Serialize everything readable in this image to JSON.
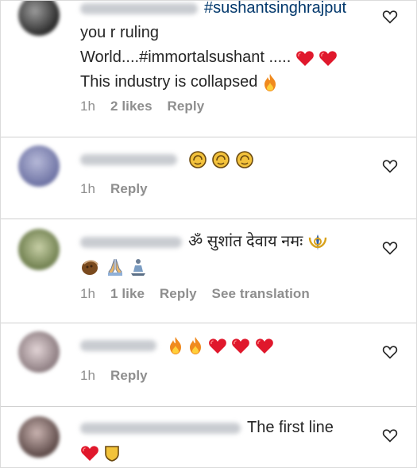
{
  "comments": [
    {
      "hashtag": "#sushantsinghrajput",
      "line2": "you r ruling",
      "line3": "World....#immortalsushant .....",
      "line4": "This industry is collapsed",
      "time": "1h",
      "likes": "2 likes",
      "reply": "Reply",
      "avatar_color": "#4a4a4a"
    },
    {
      "time": "1h",
      "reply": "Reply",
      "avatar_color": "#8a8fb8"
    },
    {
      "text": "ॐ सुशांत देवाय नमः",
      "time": "1h",
      "likes": "1 like",
      "reply": "Reply",
      "translation": "See translation",
      "avatar_color": "#8d9a6a"
    },
    {
      "time": "1h",
      "reply": "Reply",
      "avatar_color": "#a99a9e"
    },
    {
      "text": "The first line",
      "avatar_color": "#7d6c6a"
    }
  ],
  "colors": {
    "heart": "#e0182c",
    "fire": "#f08a1e",
    "hashtag": "#00376b",
    "meta": "#8e8e8e"
  },
  "icons": {
    "like_button": "heart-outline-icon"
  }
}
